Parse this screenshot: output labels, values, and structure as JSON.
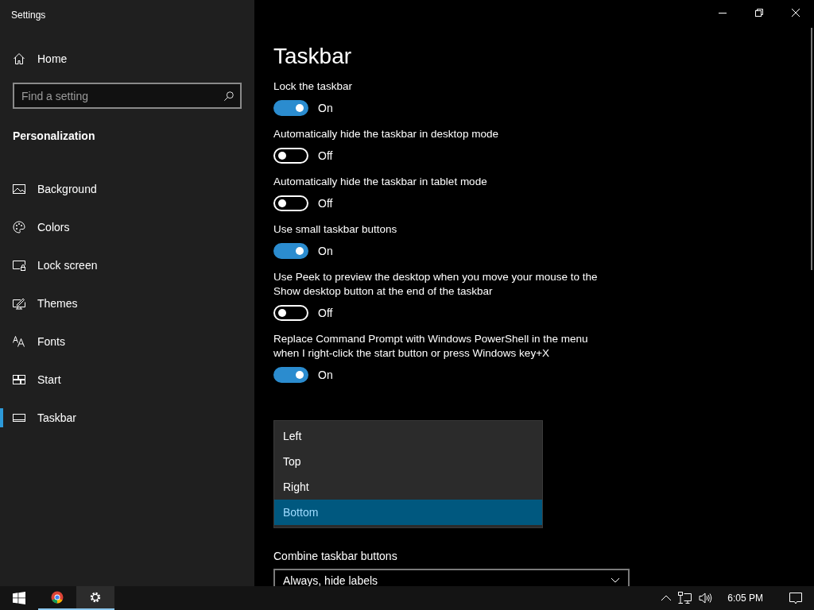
{
  "window": {
    "title": "Settings"
  },
  "sidebar": {
    "home": "Home",
    "search": {
      "placeholder": "Find a setting"
    },
    "section": "Personalization",
    "items": [
      {
        "label": "Background",
        "selected": false
      },
      {
        "label": "Colors",
        "selected": false
      },
      {
        "label": "Lock screen",
        "selected": false
      },
      {
        "label": "Themes",
        "selected": false
      },
      {
        "label": "Fonts",
        "selected": false
      },
      {
        "label": "Start",
        "selected": false
      },
      {
        "label": "Taskbar",
        "selected": true
      }
    ]
  },
  "page": {
    "title": "Taskbar",
    "settings": [
      {
        "label": "Lock the taskbar",
        "on": true,
        "state": "On"
      },
      {
        "label": "Automatically hide the taskbar in desktop mode",
        "on": false,
        "state": "Off"
      },
      {
        "label": "Automatically hide the taskbar in tablet mode",
        "on": false,
        "state": "Off"
      },
      {
        "label": "Use small taskbar buttons",
        "on": true,
        "state": "On"
      },
      {
        "label": "Use Peek to preview the desktop when you move your mouse to the Show desktop button at the end of the taskbar",
        "on": false,
        "state": "Off"
      },
      {
        "label": "Replace Command Prompt with Windows PowerShell in the menu when I right-click the start button or press Windows key+X",
        "on": true,
        "state": "On"
      }
    ],
    "location_menu": [
      {
        "label": "Left",
        "selected": false
      },
      {
        "label": "Top",
        "selected": false
      },
      {
        "label": "Right",
        "selected": false
      },
      {
        "label": "Bottom",
        "selected": true
      }
    ],
    "combine": {
      "label": "Combine taskbar buttons",
      "value": "Always, hide labels"
    }
  },
  "taskbar": {
    "apps": [
      {
        "selected": false,
        "running": true
      },
      {
        "selected": true,
        "running": true
      }
    ],
    "clock": "6:05 PM"
  }
}
